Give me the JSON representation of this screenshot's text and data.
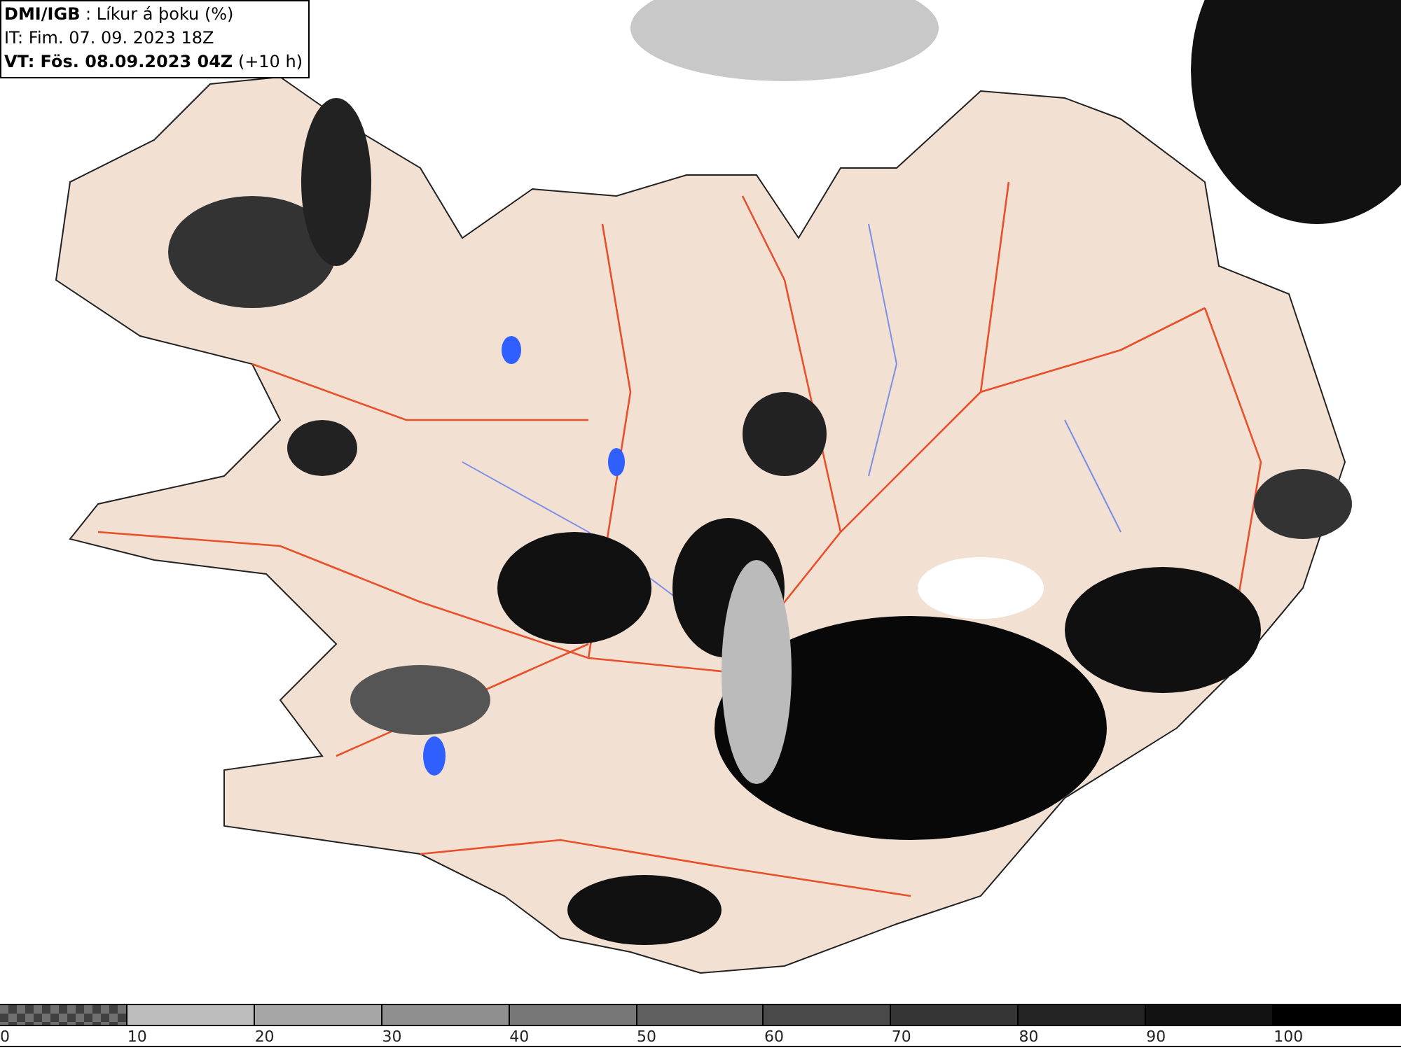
{
  "header": {
    "line_1": "**DMI/IGB** : Líkur á þoku (%)",
    "line_2": "IT: Fim. 07. 09. 2023 18Z",
    "line_3": "**VT: Fös. 08.09.2023 04Z** (+10 h)"
  },
  "legend": {
    "swatches": [
      {
        "kind": "checker"
      },
      {
        "kind": "solid",
        "color": "#bdbdbd"
      },
      {
        "kind": "solid",
        "color": "#a6a6a6"
      },
      {
        "kind": "solid",
        "color": "#8f8f8f"
      },
      {
        "kind": "solid",
        "color": "#777777"
      },
      {
        "kind": "solid",
        "color": "#606060"
      },
      {
        "kind": "solid",
        "color": "#4a4a4a"
      },
      {
        "kind": "solid",
        "color": "#353535"
      },
      {
        "kind": "solid",
        "color": "#232323"
      },
      {
        "kind": "solid",
        "color": "#121212"
      },
      {
        "kind": "solid",
        "color": "#000000"
      }
    ],
    "ticks": [
      "0",
      "10",
      "20",
      "30",
      "40",
      "50",
      "60",
      "70",
      "80",
      "90",
      "100"
    ]
  }
}
